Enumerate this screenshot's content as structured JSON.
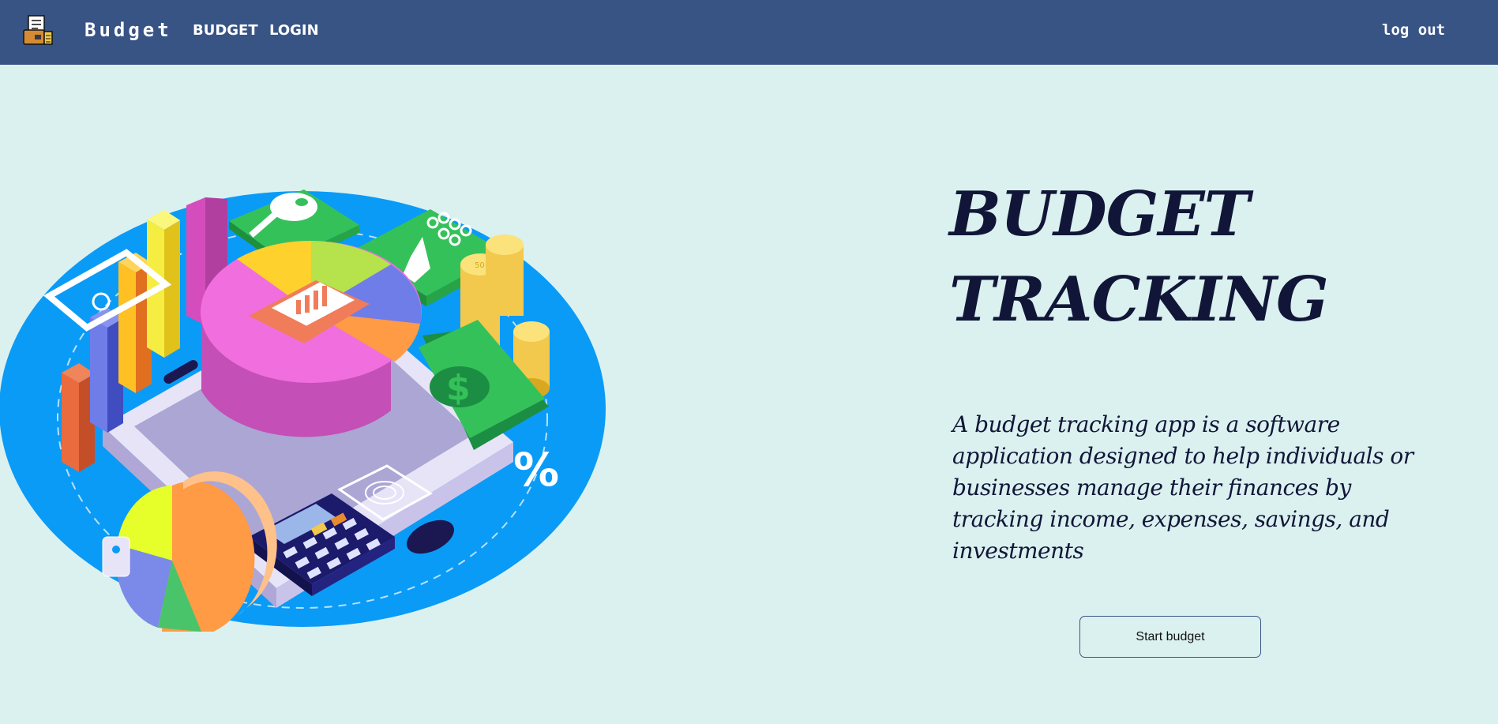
{
  "nav": {
    "logo_icon": "budget-logo-icon",
    "brand": "Budget",
    "links": [
      "BUDGET",
      "LOGIN"
    ],
    "logout": "log out",
    "color": "#375485"
  },
  "hero": {
    "title": "BUDGET\nTRACKING",
    "description": "A budget tracking app is a software application designed to help individuals or businesses manage their finances by tracking income, expenses, savings, and investments",
    "button": "Start budget",
    "illustration_icon": "finance-isometric-illustration",
    "percent_symbol": "%",
    "coin_label": "50"
  },
  "colors": {
    "background": "#dbf1ef",
    "text": "#111638",
    "accent_blue": "#0a9bf7"
  }
}
